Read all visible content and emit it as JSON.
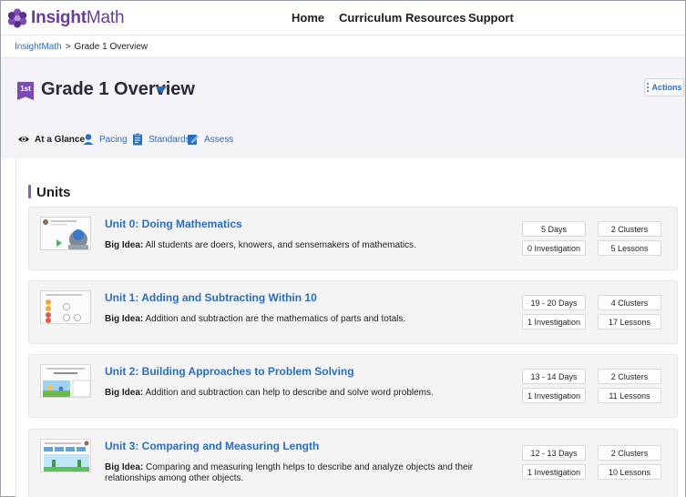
{
  "brand": {
    "insight": "Insight",
    "math": "Math",
    "color": "#6b3b9c"
  },
  "nav": [
    "Home",
    "Curriculum",
    "Resources",
    "Support"
  ],
  "breadcrumb": {
    "root": "InsightMath",
    "separator": ">",
    "current": "Grade 1 Overview"
  },
  "header": {
    "badge": "1st",
    "title": "Grade 1 Overview",
    "actions_label": "Actions"
  },
  "tabs": [
    {
      "label": "At a Glance",
      "icon": "eye-icon",
      "active": true
    },
    {
      "label": "Pacing",
      "icon": "person-icon",
      "active": false
    },
    {
      "label": "Standards",
      "icon": "clipboard-icon",
      "active": false
    },
    {
      "label": "Assess",
      "icon": "assess-icon",
      "active": false
    }
  ],
  "units_heading": "Units",
  "big_idea_label": "Big Idea:",
  "units": [
    {
      "title": "Unit 0: Doing Mathematics",
      "big_idea": "All students are doers, knowers, and sensemakers of mathematics.",
      "days": "5 Days",
      "clusters": "2 Clusters",
      "investigations": "0 Investigation",
      "lessons": "5 Lessons"
    },
    {
      "title": "Unit 1: Adding and Subtracting Within 10",
      "big_idea": "Addition and subtraction are the mathematics of parts and totals.",
      "days": "19 - 20 Days",
      "clusters": "4 Clusters",
      "investigations": "1 Investigation",
      "lessons": "17 Lessons"
    },
    {
      "title": "Unit 2: Building Approaches to Problem Solving",
      "big_idea": "Addition and subtraction can help to describe and solve word problems.",
      "days": "13 - 14 Days",
      "clusters": "2 Clusters",
      "investigations": "1 Investigation",
      "lessons": "11 Lessons"
    },
    {
      "title": "Unit 3: Comparing and Measuring Length",
      "big_idea": "Comparing and measuring length helps to describe and analyze objects and their relationships among other objects.",
      "days": "12 - 13 Days",
      "clusters": "2 Clusters",
      "investigations": "1 Investigation",
      "lessons": "10 Lessons"
    }
  ],
  "colors": {
    "link": "#2a6ebf",
    "accent": "#7a4bb5",
    "band": "#f4f3f8",
    "card": "#f4f4f5"
  }
}
